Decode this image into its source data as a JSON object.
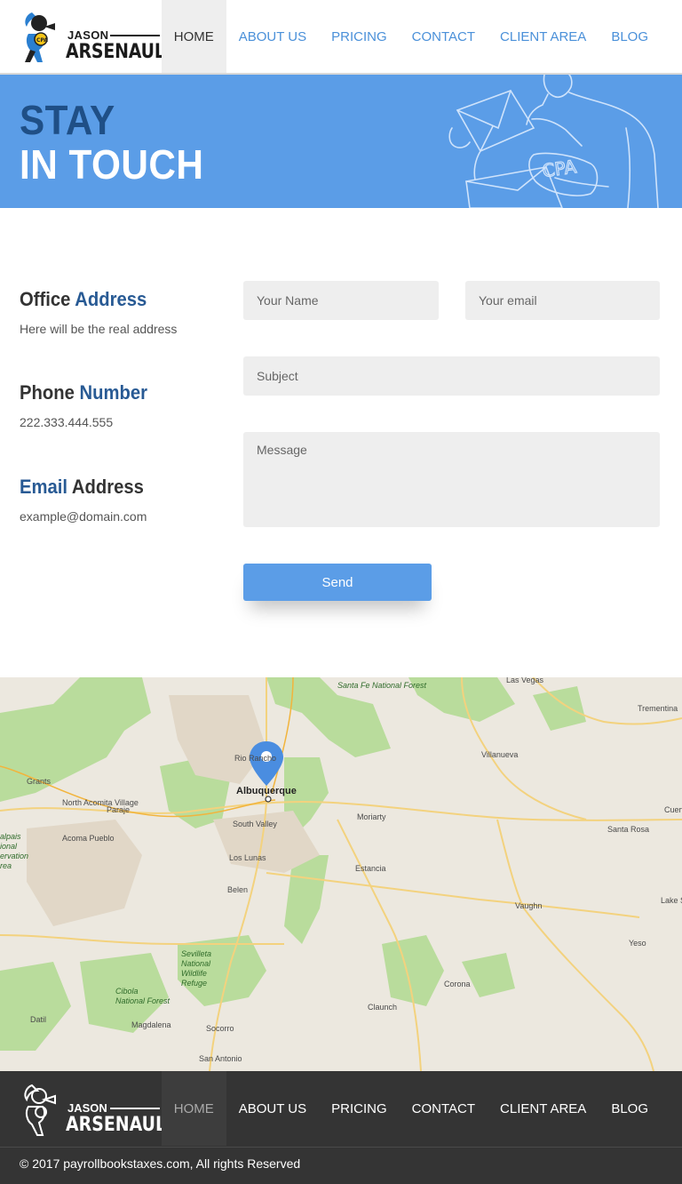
{
  "header": {
    "logo": {
      "line1": "JASON",
      "line2": "ARSENAULT"
    },
    "nav": [
      {
        "label": "HOME",
        "active": true
      },
      {
        "label": "ABOUT US",
        "active": false
      },
      {
        "label": "PRICING",
        "active": false
      },
      {
        "label": "CONTACT",
        "active": false
      },
      {
        "label": "CLIENT AREA",
        "active": false
      },
      {
        "label": "BLOG",
        "active": false
      }
    ]
  },
  "hero": {
    "line1": "STAY",
    "line2": "IN TOUCH",
    "art_label": "CPA"
  },
  "contact_info": {
    "office": {
      "title_a": "Office",
      "title_b": "Address",
      "text": "Here will be the real address"
    },
    "phone": {
      "title_a": "Phone",
      "title_b": "Number",
      "text": "222.333.444.555"
    },
    "email": {
      "title_a": "Email",
      "title_b": "Address",
      "text": "example@domain.com"
    }
  },
  "form": {
    "name_placeholder": "Your Name",
    "email_placeholder": "Your email",
    "subject_placeholder": "Subject",
    "message_placeholder": "Message",
    "send_label": "Send"
  },
  "map": {
    "labels": {
      "santa_fe": "Santa Fe\nNational Forest",
      "las_vegas": "Las Vegas",
      "trementina": "Trementina",
      "rio_rancho": "Rio Rancho",
      "villanueva": "Villanueva",
      "grants": "Grants",
      "albuquerque": "Albuquerque",
      "north_acomita": "North Acomita\nVillage",
      "paraje": "Paraje",
      "south_valley": "South Valley",
      "moriarty": "Moriarty",
      "santa_rosa": "Santa Rosa",
      "acoma_pueblo": "Acoma Pueblo",
      "los_lunas": "Los Lunas",
      "estancia": "Estancia",
      "belen": "Belen",
      "vaughn": "Vaughn",
      "lake_s": "Lake S",
      "yeso": "Yeso",
      "sevilleta": "Sevilleta\nNational\nWildlife\nRefuge",
      "corona": "Corona",
      "cibola": "Cibola\nNational Forest",
      "claunch": "Claunch",
      "datil": "Datil",
      "magdalena": "Magdalena",
      "socorro": "Socorro",
      "san_antonio": "San Antonio",
      "cuervo": "Cuerv",
      "alpais": "alpais\nional\nervation\nrea"
    }
  },
  "footer": {
    "logo": {
      "line1": "JASON",
      "line2": "ARSENAULT"
    },
    "nav": [
      {
        "label": "HOME",
        "active": true
      },
      {
        "label": "ABOUT US",
        "active": false
      },
      {
        "label": "PRICING",
        "active": false
      },
      {
        "label": "CONTACT",
        "active": false
      },
      {
        "label": "CLIENT AREA",
        "active": false
      },
      {
        "label": "BLOG",
        "active": false
      }
    ],
    "copyright": "© 2017 payrollbookstaxes.com, All rights Reserved"
  },
  "colors": {
    "accent": "#5b9de7",
    "dark_blue": "#285a94",
    "link": "#4a90d9",
    "footer_bg": "#343434"
  }
}
